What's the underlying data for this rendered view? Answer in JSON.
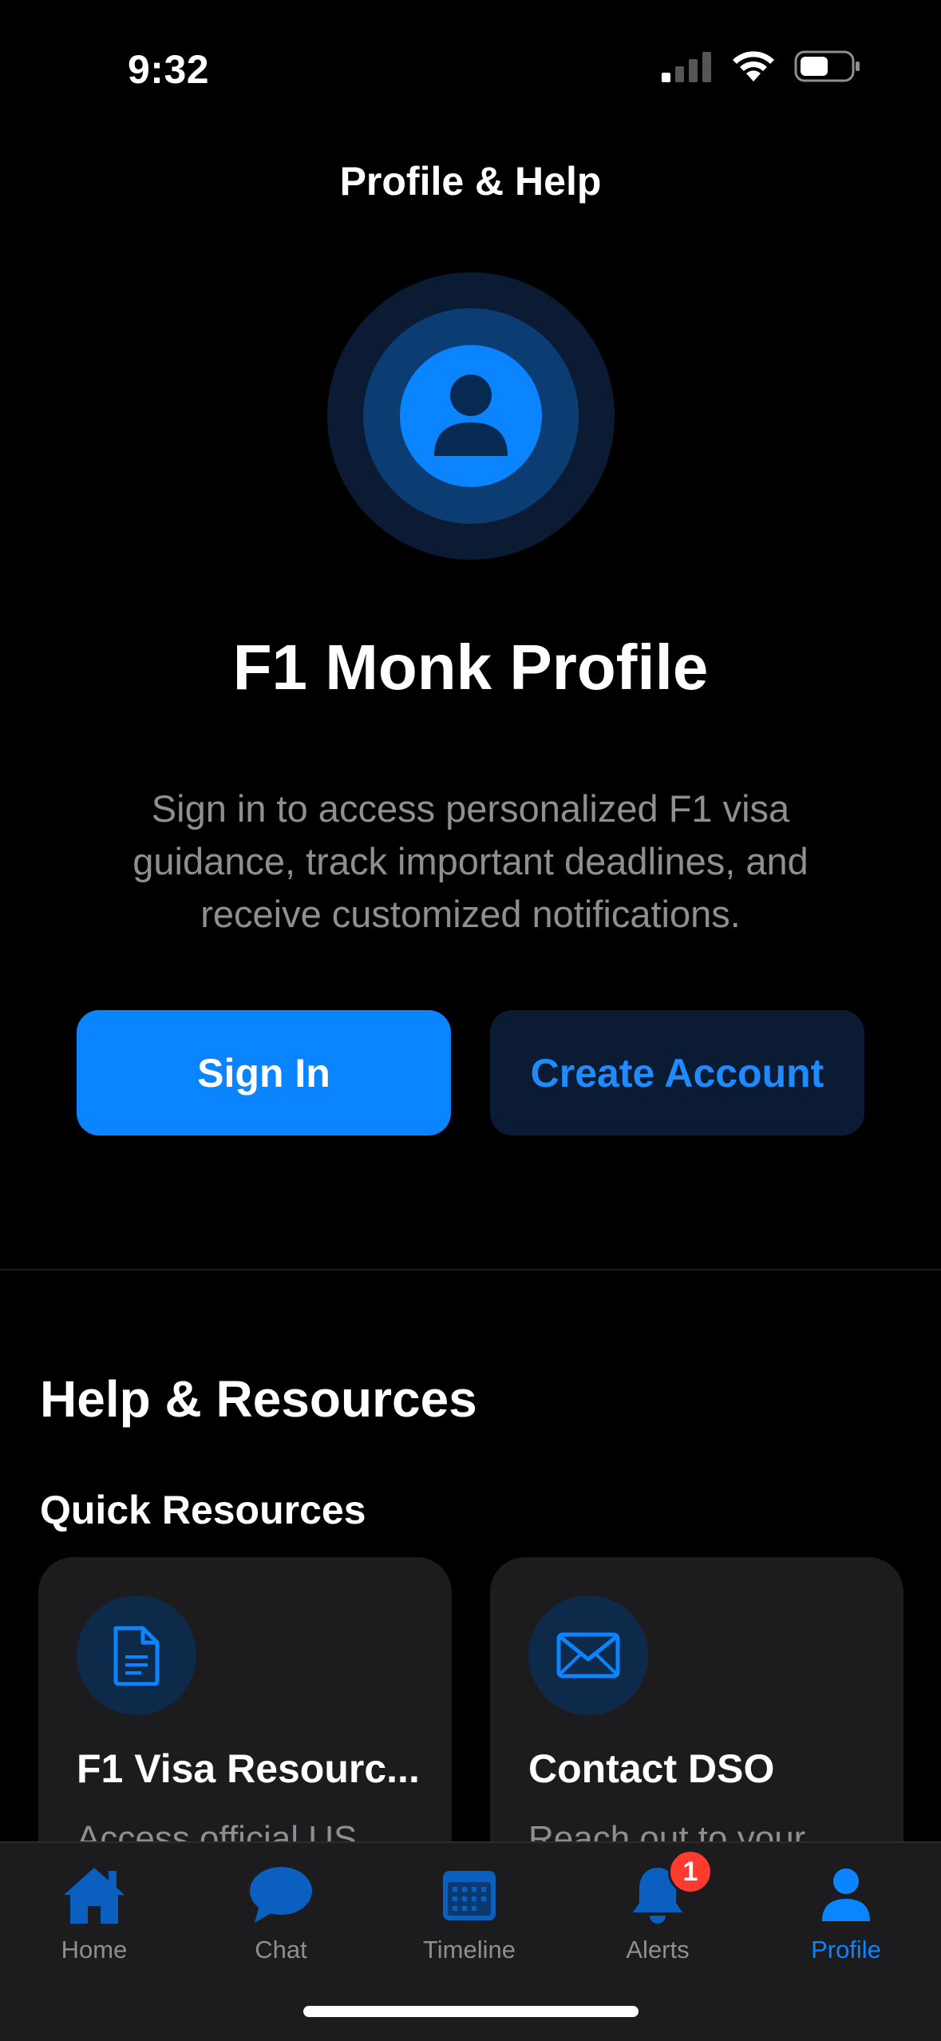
{
  "status_bar": {
    "time": "9:32",
    "icons": [
      "cellular-signal-icon",
      "wifi-icon",
      "battery-icon"
    ]
  },
  "nav": {
    "title": "Profile & Help"
  },
  "profile": {
    "avatar_icon": "person-icon",
    "title": "F1 Monk Profile",
    "description": "Sign in to access personalized F1 visa guidance, track important deadlines, and receive customized notifications.",
    "sign_in_label": "Sign In",
    "create_account_label": "Create Account"
  },
  "help": {
    "section_title": "Help & Resources",
    "quick_resources_title": "Quick Resources",
    "cards": [
      {
        "icon": "document-icon",
        "title": "F1 Visa Resourc...",
        "description": "Access official US"
      },
      {
        "icon": "envelope-icon",
        "title": "Contact DSO",
        "description": "Reach out to your"
      }
    ]
  },
  "tab_bar": {
    "tabs": [
      {
        "label": "Home",
        "icon": "house-icon",
        "active": false
      },
      {
        "label": "Chat",
        "icon": "chat-bubble-icon",
        "active": false
      },
      {
        "label": "Timeline",
        "icon": "calendar-icon",
        "active": false
      },
      {
        "label": "Alerts",
        "icon": "bell-icon",
        "active": false,
        "badge": "1"
      },
      {
        "label": "Profile",
        "icon": "person-icon",
        "active": true
      }
    ]
  },
  "colors": {
    "accent": "#0a84ff",
    "background": "#000000",
    "card": "#1c1c1e",
    "secondary_text": "#8e8e93",
    "badge": "#ff3b30"
  }
}
